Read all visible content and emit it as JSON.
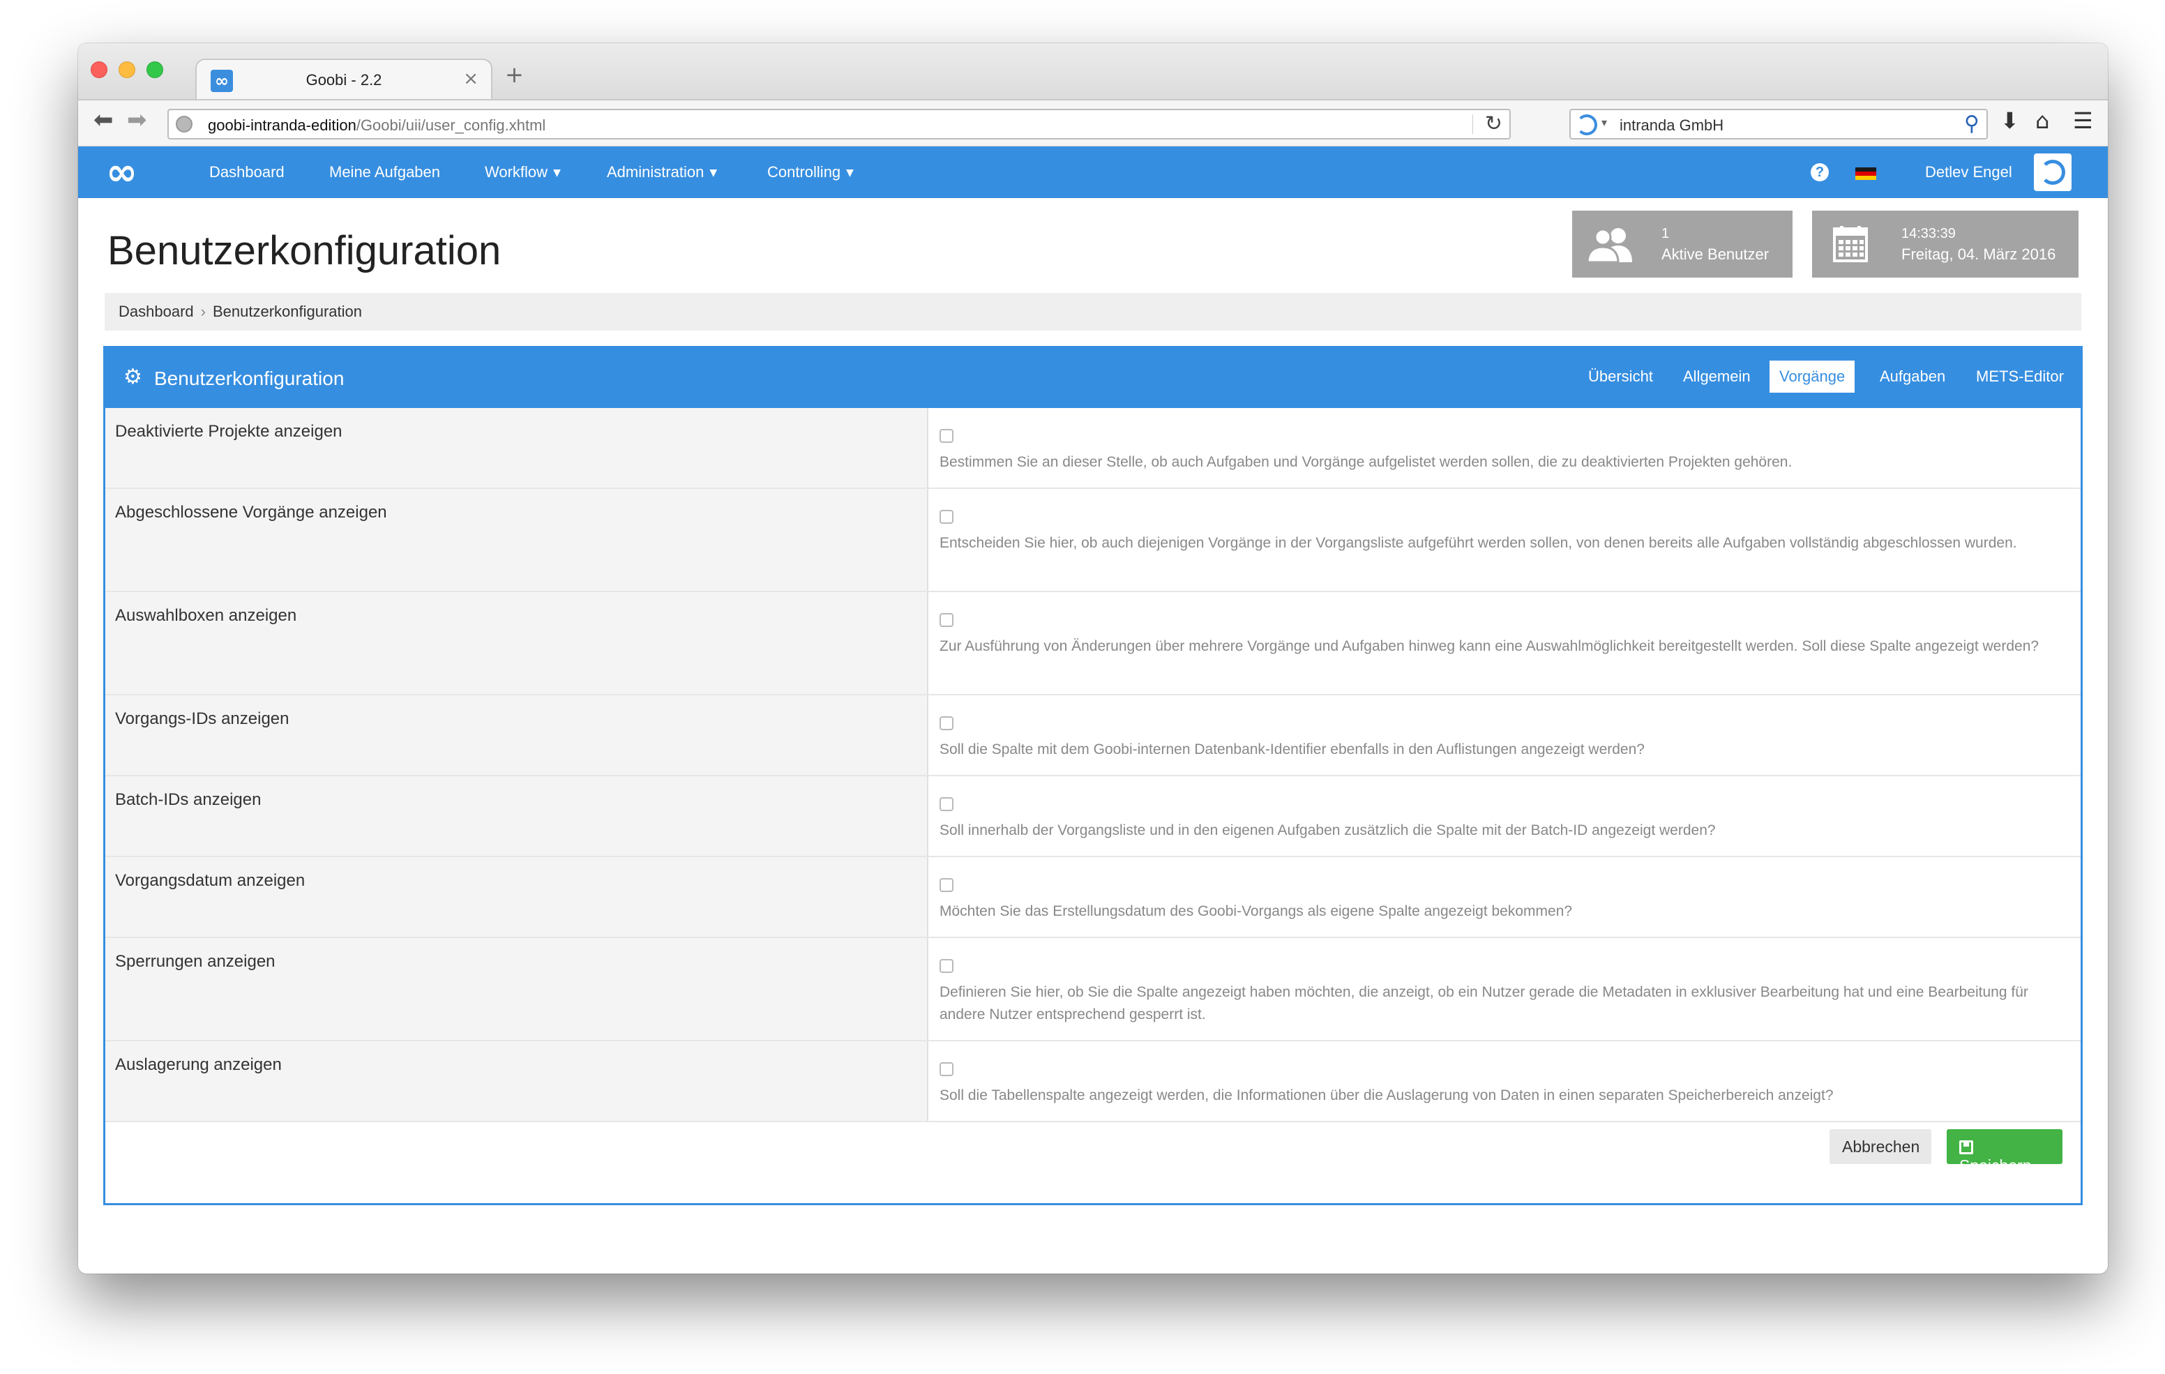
{
  "browser": {
    "tab_title": "Goobi - 2.2",
    "tab_close": "×",
    "new_tab": "+",
    "url_host": "goobi-intranda-edition",
    "url_path": "/Goobi/uii/user_config.xhtml",
    "search_engine_label": "intranda GmbH",
    "icons": [
      "back-arrow-icon",
      "forward-arrow-icon",
      "globe-icon",
      "reload-icon",
      "search-engine-icon",
      "search-icon",
      "download-icon",
      "home-icon",
      "menu-icon"
    ]
  },
  "navbar": {
    "logo": "∞",
    "items": [
      {
        "label": "Dashboard",
        "dropdown": false
      },
      {
        "label": "Meine Aufgaben",
        "dropdown": false
      },
      {
        "label": "Workflow",
        "dropdown": true
      },
      {
        "label": "Administration",
        "dropdown": true
      },
      {
        "label": "Controlling",
        "dropdown": true
      }
    ],
    "help": "?",
    "user_name": "Detlev Engel",
    "accent_color": "#368ee0"
  },
  "header": {
    "title": "Benutzerkonfiguration",
    "active_users": {
      "count": "1",
      "label": "Aktive Benutzer"
    },
    "clock": {
      "time": "14:33:39",
      "date": "Freitag, 04. März 2016"
    }
  },
  "breadcrumb": [
    "Dashboard",
    "Benutzerkonfiguration"
  ],
  "panel": {
    "title": "Benutzerkonfiguration",
    "tabs": [
      {
        "label": "Übersicht",
        "active": false
      },
      {
        "label": "Allgemein",
        "active": false
      },
      {
        "label": "Vorgänge",
        "active": true
      },
      {
        "label": "Aufgaben",
        "active": false
      },
      {
        "label": "METS-Editor",
        "active": false
      }
    ],
    "rows": [
      {
        "label": "Deaktivierte Projekte anzeigen",
        "checked": false,
        "help": "Bestimmen Sie an dieser Stelle, ob auch Aufgaben und Vorgänge aufgelistet werden sollen, die zu deaktivierten Projekten gehören."
      },
      {
        "label": "Abgeschlossene Vorgänge anzeigen",
        "checked": false,
        "help": "Entscheiden Sie hier, ob auch diejenigen Vorgänge in der Vorgangsliste aufgeführt werden sollen, von denen bereits alle Aufgaben vollständig abgeschlossen wurden."
      },
      {
        "label": "Auswahlboxen anzeigen",
        "checked": false,
        "help": "Zur Ausführung von Änderungen über mehrere Vorgänge und Aufgaben hinweg kann eine Auswahlmöglichkeit bereitgestellt werden. Soll diese Spalte angezeigt werden?"
      },
      {
        "label": "Vorgangs-IDs anzeigen",
        "checked": false,
        "help": "Soll die Spalte mit dem Goobi-internen Datenbank-Identifier ebenfalls in den Auflistungen angezeigt werden?"
      },
      {
        "label": "Batch-IDs anzeigen",
        "checked": false,
        "help": "Soll innerhalb der Vorgangsliste und in den eigenen Aufgaben zusätzlich die Spalte mit der Batch-ID angezeigt werden?"
      },
      {
        "label": "Vorgangsdatum anzeigen",
        "checked": false,
        "help": "Möchten Sie das Erstellungsdatum des Goobi-Vorgangs als eigene Spalte angezeigt bekommen?"
      },
      {
        "label": "Sperrungen anzeigen",
        "checked": false,
        "help": "Definieren Sie hier, ob Sie die Spalte angezeigt haben möchten, die anzeigt, ob ein Nutzer gerade die Metadaten in exklusiver Bearbeitung hat und eine Bearbeitung für andere Nutzer entsprechend gesperrt ist."
      },
      {
        "label": "Auslagerung anzeigen",
        "checked": false,
        "help": "Soll die Tabellenspalte angezeigt werden, die Informationen über die Auslagerung von Daten in einen separaten Speicherbereich anzeigt?"
      }
    ],
    "buttons": {
      "cancel": "Abbrechen",
      "save": "Speichern"
    },
    "save_color": "#42b344"
  }
}
